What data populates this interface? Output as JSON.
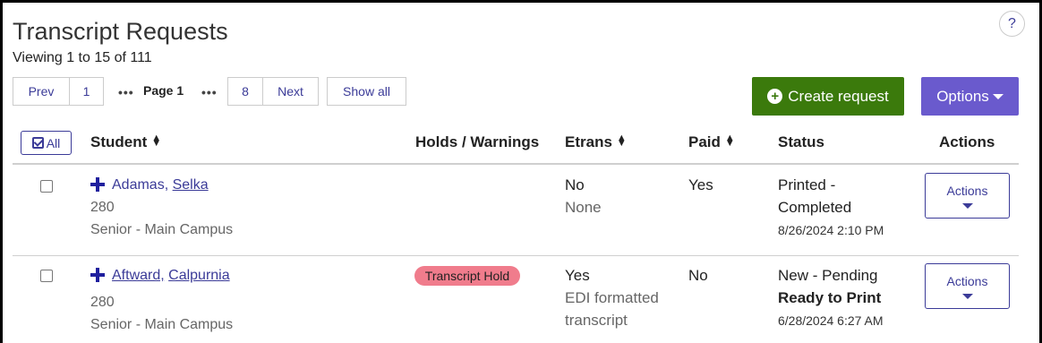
{
  "page": {
    "title": "Transcript Requests",
    "viewing": "Viewing 1 to 15 of 111",
    "help_label": "?"
  },
  "pager": {
    "prev": "Prev",
    "first": "1",
    "dots": "•••",
    "current": "Page 1",
    "last": "8",
    "next": "Next",
    "show_all": "Show all"
  },
  "toolbar": {
    "create": "Create request",
    "options": "Options"
  },
  "table": {
    "select_all": "All",
    "headers": {
      "student": "Student",
      "holds": "Holds / Warnings",
      "etrans": "Etrans",
      "paid": "Paid",
      "status": "Status",
      "actions": "Actions"
    },
    "rows": [
      {
        "last_name": "Adamas,",
        "first_name": "Selka",
        "id": "280",
        "program": "Senior - Main Campus",
        "hold": "",
        "etrans": "No",
        "etrans_format_1": "None",
        "etrans_format_2": "",
        "paid": "Yes",
        "status_1": "Printed -",
        "status_2": "Completed",
        "date": "8/26/2024 2:10 PM",
        "action": "Actions"
      },
      {
        "last_name": "Aftward,",
        "first_name": "Calpurnia",
        "id": "280",
        "program": "Senior - Main Campus",
        "hold": "Transcript Hold",
        "etrans": "Yes",
        "etrans_format_1": "EDI formatted",
        "etrans_format_2": "transcript",
        "paid": "No",
        "status_1": "New - Pending",
        "status_2": "Ready to Print",
        "date": "6/28/2024 6:27 AM",
        "action": "Actions"
      }
    ]
  },
  "colors": {
    "create": "#3b7a0c",
    "options": "#6a5acd",
    "link": "#3b3b98",
    "hold": "#f07c8c"
  }
}
